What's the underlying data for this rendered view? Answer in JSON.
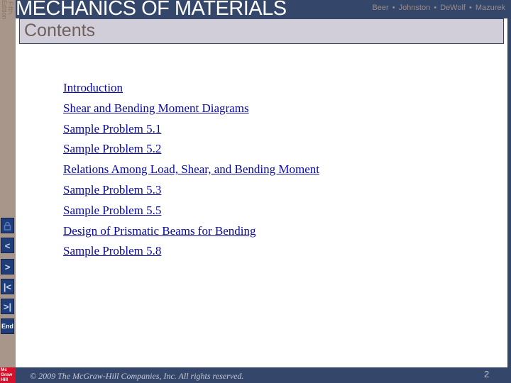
{
  "header": {
    "edition_line1": "Fifth",
    "edition_line2": "Edition",
    "title": "MECHANICS OF MATERIALS",
    "authors": [
      "Beer",
      "Johnston",
      "DeWolf",
      "Mazurek"
    ],
    "separator": "•"
  },
  "slide": {
    "title": "Contents",
    "links": [
      "Introduction",
      "Shear and Bending Moment Diagrams",
      "Sample Problem 5.1",
      "Sample Problem 5.2",
      "Relations Among Load, Shear, and Bending Moment",
      "Sample Problem 5.3",
      "Sample Problem 5.5",
      "Design of Prismatic Beams for Bending",
      "Sample Problem 5.8"
    ]
  },
  "nav": {
    "home_icon": "lock-icon",
    "prev": "<",
    "next": ">",
    "first": "|<",
    "last": ">|",
    "end": "End"
  },
  "footer": {
    "copyright": "© 2009 The McGraw-Hill Companies, Inc. All rights reserved.",
    "page_number": "2",
    "logo_lines": [
      "Mc",
      "Graw",
      "Hill"
    ]
  },
  "colors": {
    "header_bg": "#34476b",
    "sidebar_bg": "#a8968a",
    "title_box_bg": "#d1ced9",
    "link": "#0a0aa0",
    "logo_red": "#d6102a"
  }
}
